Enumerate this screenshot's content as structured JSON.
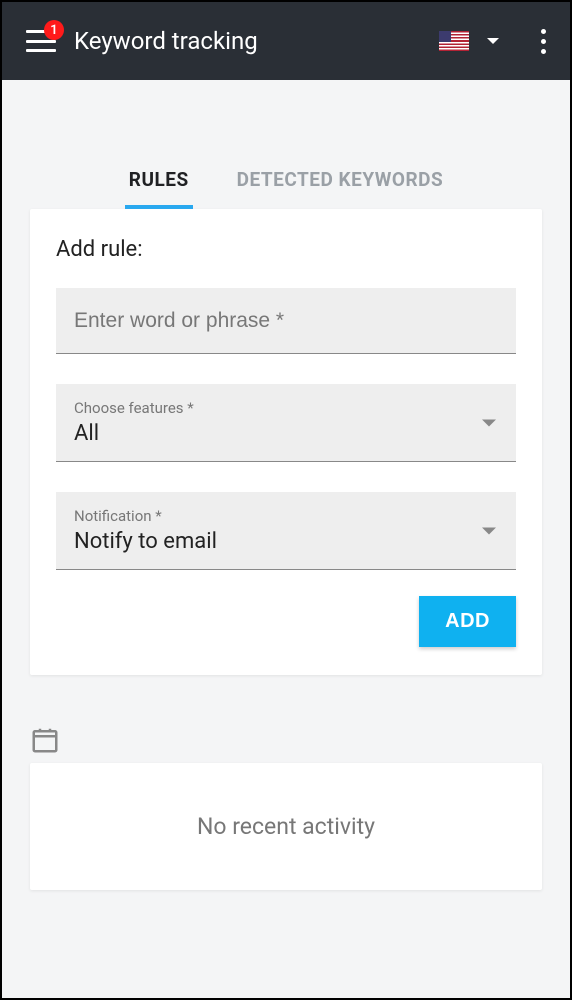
{
  "header": {
    "title": "Keyword tracking",
    "badge_count": "1",
    "locale_flag": "us"
  },
  "tabs": {
    "rules": "RULES",
    "detected": "DETECTED KEYWORDS",
    "active": "rules"
  },
  "form": {
    "title": "Add rule:",
    "keyword": {
      "placeholder": "Enter word or phrase *",
      "value": ""
    },
    "features": {
      "label": "Choose features *",
      "value": "All"
    },
    "notification": {
      "label": "Notification *",
      "value": "Notify to email"
    },
    "submit_label": "ADD"
  },
  "activity": {
    "empty_text": "No recent activity"
  }
}
